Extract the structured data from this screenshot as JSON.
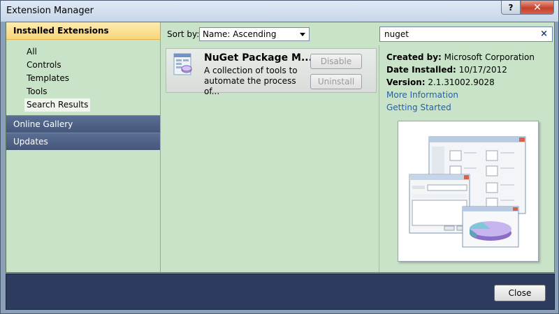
{
  "window": {
    "title": "Extension Manager",
    "help_label": "?",
    "close_label": "✕"
  },
  "sidebar": {
    "header": "Installed Extensions",
    "items": [
      {
        "label": "All"
      },
      {
        "label": "Controls"
      },
      {
        "label": "Templates"
      },
      {
        "label": "Tools"
      },
      {
        "label": "Search Results",
        "selected": true
      }
    ],
    "sections": [
      {
        "label": "Online Gallery"
      },
      {
        "label": "Updates"
      }
    ]
  },
  "toolbar": {
    "sort_label": "Sort by:",
    "sort_value": "Name: Ascending",
    "search_value": "nuget",
    "clear_label": "×"
  },
  "extension": {
    "name": "NuGet Package M...",
    "description": "A collection of tools to automate the process of...",
    "disable_label": "Disable",
    "uninstall_label": "Uninstall"
  },
  "details": {
    "created_by_label": "Created by:",
    "created_by": "Microsoft Corporation",
    "date_label": "Date Installed:",
    "date": "10/17/2012",
    "version_label": "Version:",
    "version": "2.1.31002.9028",
    "more_info": "More Information",
    "getting_started": "Getting Started"
  },
  "footer": {
    "close_label": "Close"
  }
}
